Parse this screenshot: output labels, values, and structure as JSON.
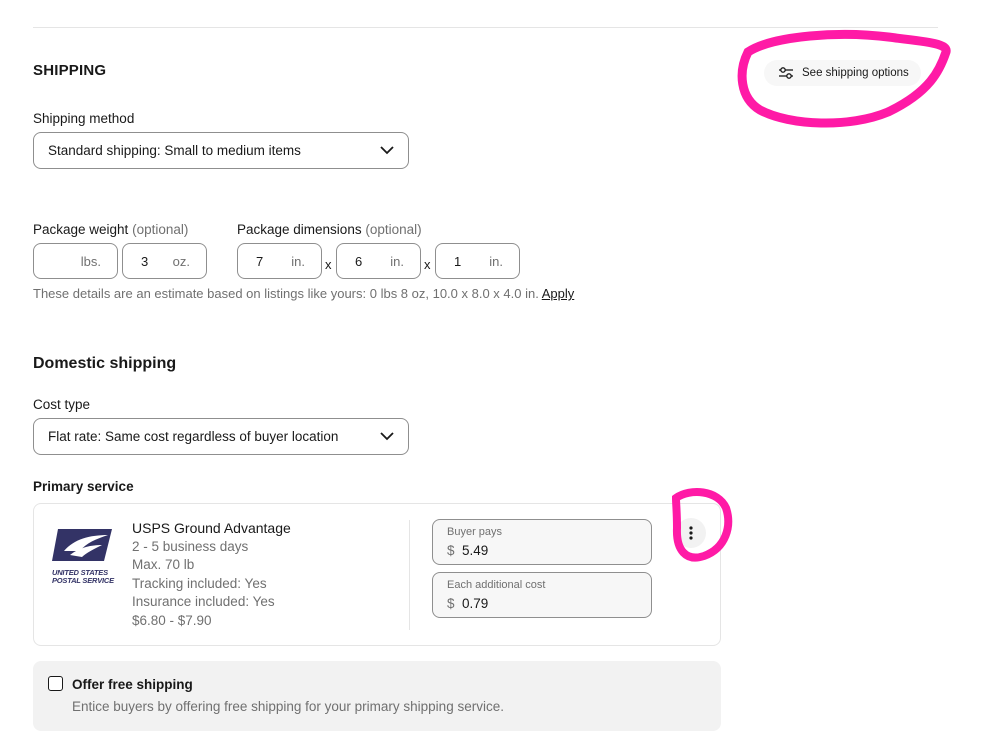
{
  "shipping": {
    "title": "SHIPPING",
    "see_options_label": "See shipping options",
    "method_label": "Shipping method",
    "method_value": "Standard shipping: Small to medium items"
  },
  "package": {
    "weight_label": "Package weight",
    "dimensions_label": "Package dimensions",
    "optional": "(optional)",
    "weight_lbs": "",
    "weight_lbs_unit": "lbs.",
    "weight_oz": "3",
    "weight_oz_unit": "oz.",
    "length": "7",
    "width": "6",
    "height": "1",
    "dim_unit": "in.",
    "times": "x",
    "hint": "These details are an estimate based on listings like yours: 0 lbs 8 oz, 10.0 x 8.0 x 4.0 in.",
    "apply": "Apply"
  },
  "domestic": {
    "title": "Domestic shipping",
    "cost_type_label": "Cost type",
    "cost_type_value": "Flat rate: Same cost regardless of buyer location",
    "primary_label": "Primary service"
  },
  "service": {
    "logo_line1": "UNITED STATES",
    "logo_line2": "POSTAL SERVICE",
    "name": "USPS Ground Advantage",
    "details": [
      "2 - 5 business days",
      "Max. 70 lb",
      "Tracking included: Yes",
      "Insurance included: Yes",
      "$6.80 - $7.90"
    ],
    "buyer_pays_label": "Buyer pays",
    "buyer_pays_value": "5.49",
    "additional_label": "Each additional cost",
    "additional_value": "0.79",
    "currency": "$"
  },
  "free_shipping": {
    "label": "Offer free shipping",
    "description": "Entice buyers by offering free shipping for your primary shipping service."
  },
  "colors": {
    "annotation": "#ff1aa6",
    "usps_blue": "#333366"
  }
}
